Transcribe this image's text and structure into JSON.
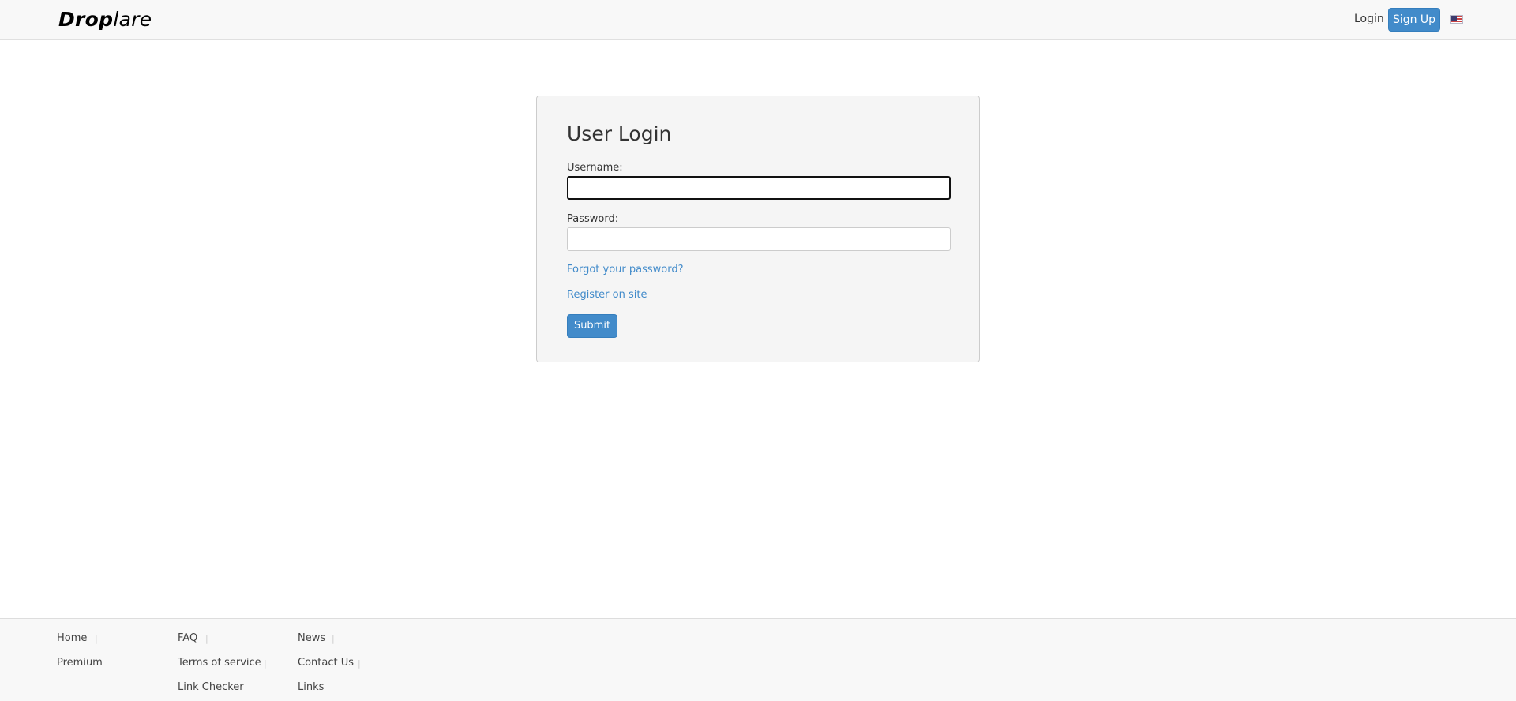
{
  "header": {
    "brand_bold": "Drop",
    "brand_light": "lare",
    "login_label": "Login",
    "signup_label": "Sign Up",
    "flag_icon": "us-flag-icon"
  },
  "login_form": {
    "title": "User Login",
    "username_label": "Username:",
    "username_value": "",
    "password_label": "Password:",
    "password_value": "",
    "forgot_link": "Forgot your password?",
    "register_link": "Register on site",
    "submit_label": "Submit"
  },
  "footer": {
    "links": [
      "Home",
      "Premium",
      "FAQ",
      "Terms of service",
      "Link Checker",
      "News",
      "Contact Us",
      "Links"
    ],
    "separator": "|"
  },
  "colors": {
    "accent": "#428bca",
    "navbar_bg": "#f8f8f8",
    "panel_bg": "#f5f5f5"
  }
}
